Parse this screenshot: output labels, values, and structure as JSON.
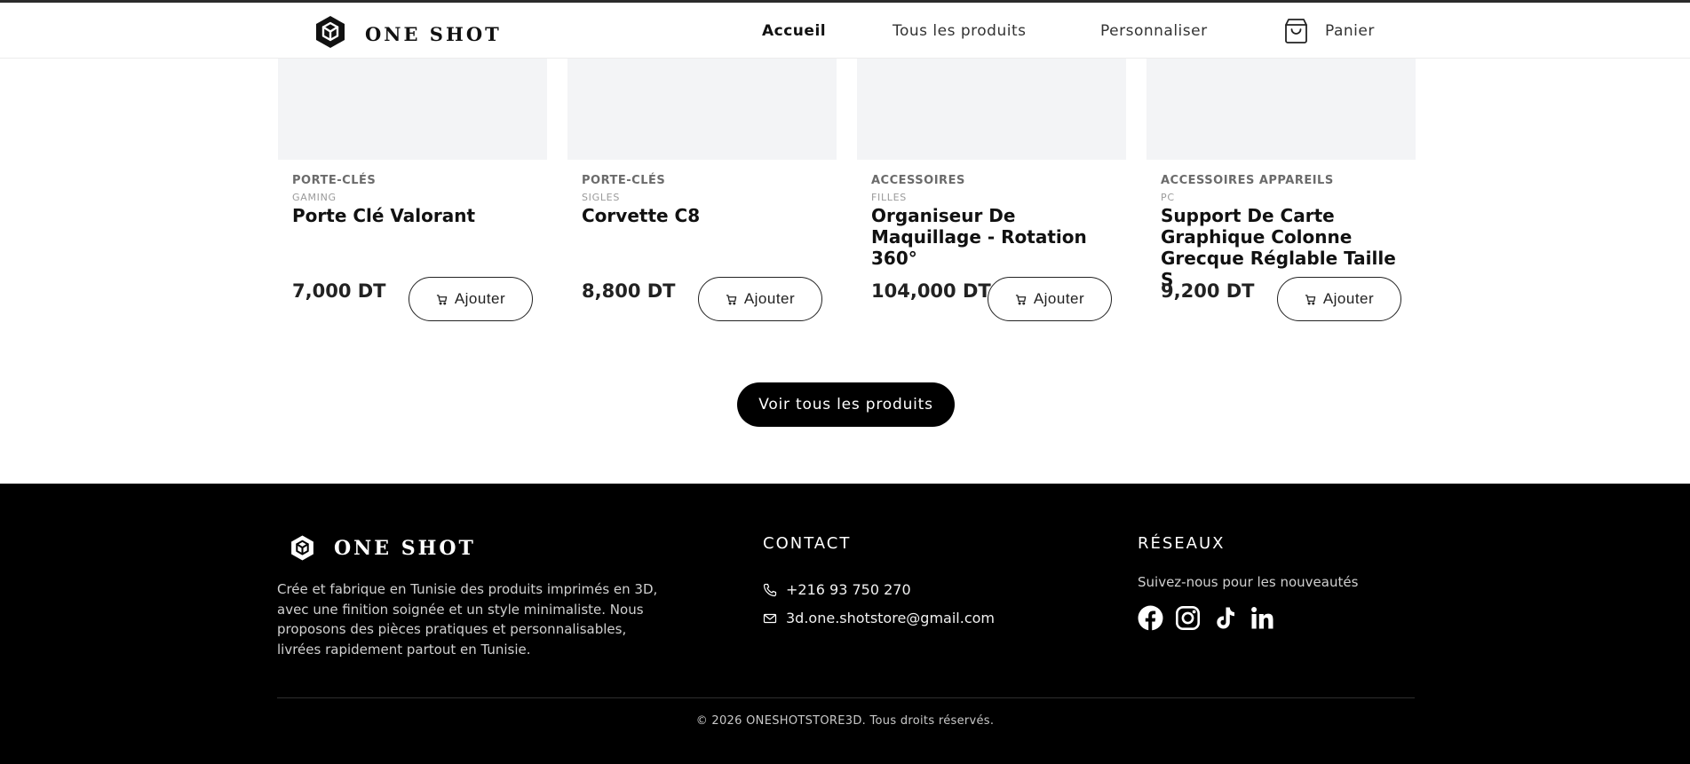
{
  "header": {
    "brand": "ONE SHOT",
    "nav": {
      "home": "Accueil",
      "products": "Tous les produits",
      "customize": "Personnaliser",
      "cart": "Panier"
    }
  },
  "products": [
    {
      "category": "PORTE-CLÉS",
      "subcategory": "GAMING",
      "name": "Porte Clé Valorant",
      "price": "7,000 DT",
      "add_label": "Ajouter"
    },
    {
      "category": "PORTE-CLÉS",
      "subcategory": "SIGLES",
      "name": "Corvette C8",
      "price": "8,800 DT",
      "add_label": "Ajouter"
    },
    {
      "category": "ACCESSOIRES",
      "subcategory": "FILLES",
      "name": "Organiseur De Maquillage - Rotation 360°",
      "price": "104,000 DT",
      "add_label": "Ajouter"
    },
    {
      "category": "ACCESSOIRES APPAREILS",
      "subcategory": "PC",
      "name": "Support De Carte Graphique Colonne Grecque Réglable Taille S",
      "price": "9,200 DT",
      "add_label": "Ajouter"
    }
  ],
  "see_all_label": "Voir tous les produits",
  "footer": {
    "brand": "ONE SHOT",
    "about": "Crée et fabrique en Tunisie des produits imprimés en 3D, avec une finition soignée et un style minimaliste. Nous proposons des pièces pratiques et personnalisables, livrées rapidement partout en Tunisie.",
    "contact_heading": "CONTACT",
    "phone": "+216 93 750 270",
    "email": "3d.one.shotstore@gmail.com",
    "social_heading": "RÉSEAUX",
    "social_tagline": "Suivez-nous pour les nouveautés",
    "socials": [
      "facebook-icon",
      "instagram-icon",
      "tiktok-icon",
      "linkedin-icon"
    ],
    "copyright": "© 2026 ONESHOTSTORE3D. Tous droits réservés."
  },
  "colors": {
    "footer_bg": "#000000",
    "card_image_bg": "#f3f4f6",
    "primary_button_bg": "#000000"
  }
}
